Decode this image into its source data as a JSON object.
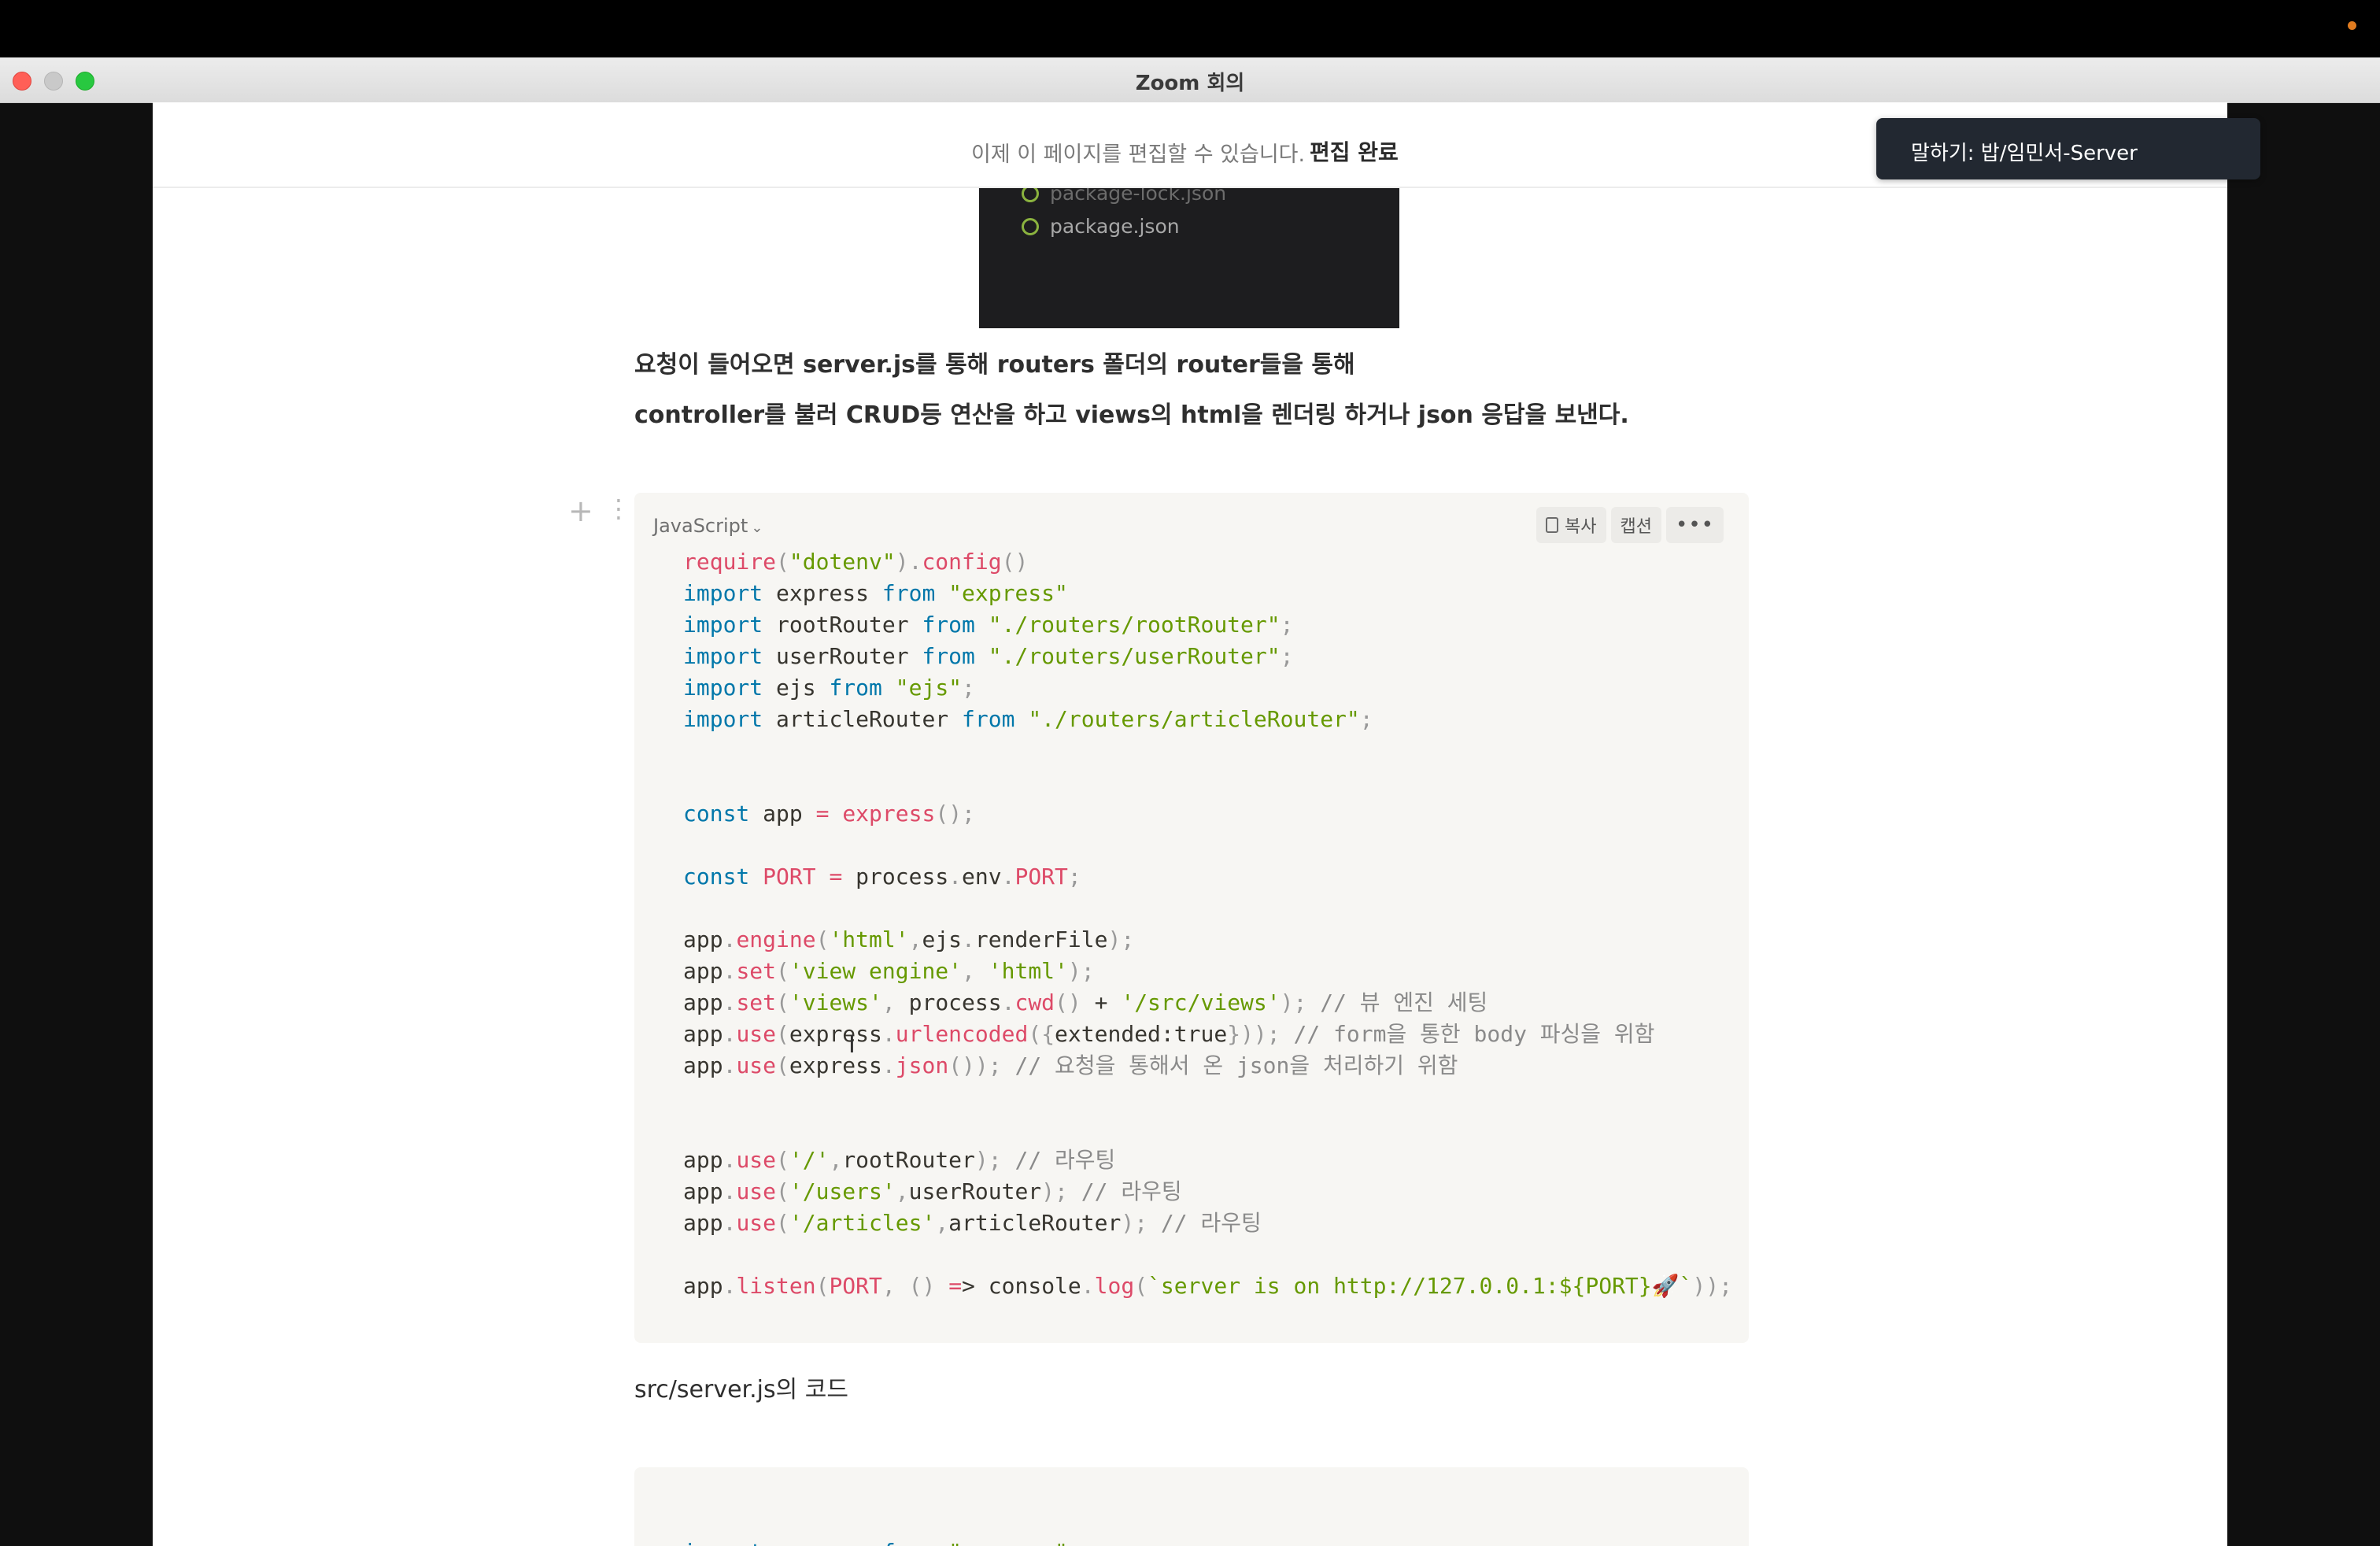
{
  "window": {
    "title": "Zoom 회의"
  },
  "speaker": {
    "label": "말하기: 밥/임민서-Server"
  },
  "edit_banner": {
    "message": "이제 이 페이지를 편집할 수 있습니다.",
    "done_label": "편집 완료"
  },
  "embedded_image": {
    "faded_file": "package-lock.json",
    "file": "package.json"
  },
  "paragraphs": [
    "요청이 들어오면 server.js를 통해 routers 폴더의 router들을 통해",
    "controller를 불러 CRUD등 연산을 하고 views의 html을 렌더링 하거나 json 응답을 보낸다."
  ],
  "block_handles": {
    "add": "+",
    "drag": "⋮⋮"
  },
  "code_block": {
    "language": "JavaScript",
    "copy_label": "복사",
    "caption_label": "캡션",
    "more_label": "•••",
    "lines": [
      "require(\"dotenv\").config()",
      "import express from \"express\"",
      "import rootRouter from \"./routers/rootRouter\";",
      "import userRouter from \"./routers/userRouter\";",
      "import ejs from \"ejs\";",
      "import articleRouter from \"./routers/articleRouter\";",
      "",
      "",
      "const app = express();",
      "",
      "const PORT = process.env.PORT;",
      "",
      "app.engine('html',ejs.renderFile);",
      "app.set('view engine', 'html');",
      "app.set('views', process.cwd() + '/src/views'); // 뷰 엔진 세팅",
      "app.use(express.urlencoded({extended:true})); // form을 통한 body 파싱을 위함",
      "app.use(express.json()); // 요청을 통해서 온 json을 처리하기 위함",
      "",
      "",
      "app.use('/',rootRouter); // 라우팅",
      "app.use('/users',userRouter); // 라우팅",
      "app.use('/articles',articleRouter); // 라우팅",
      "",
      "app.listen(PORT, () => console.log(`server is on http://127.0.0.1:${PORT}🚀`));"
    ]
  },
  "caption": "src/server.js의 코드",
  "code_block_2": {
    "lines": [
      "import express from \"express\""
    ]
  },
  "colors": {
    "keyword": "#0077aa",
    "function": "#dd4a68",
    "string": "#669900",
    "comment": "#8a8a8a"
  }
}
